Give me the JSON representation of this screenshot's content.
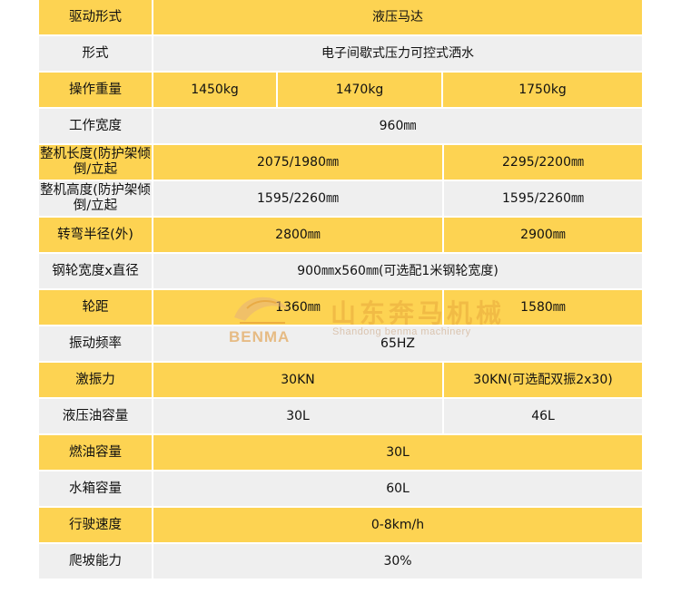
{
  "rows": [
    {
      "label": "驱动形式",
      "values": [
        "液压马达"
      ]
    },
    {
      "label": "形式",
      "values": [
        "电子间歇式压力可控式洒水"
      ]
    },
    {
      "label": "操作重量",
      "values": [
        "1450kg",
        "1470kg",
        "1750kg"
      ]
    },
    {
      "label": "工作宽度",
      "values": [
        "960㎜"
      ]
    },
    {
      "label": "整机长度(防护架倾倒/立起",
      "values": [
        "2075/1980㎜",
        "2295/2200㎜"
      ]
    },
    {
      "label": "整机高度(防护架倾倒/立起",
      "values": [
        "1595/2260㎜",
        "1595/2260㎜"
      ]
    },
    {
      "label": "转弯半径(外)",
      "values": [
        "2800㎜",
        "2900㎜"
      ]
    },
    {
      "label": "钢轮宽度x直径",
      "values": [
        "900㎜x560㎜(可选配1米钢轮宽度)"
      ]
    },
    {
      "label": "轮距",
      "values": [
        "1360㎜",
        "1580㎜"
      ]
    },
    {
      "label": "振动频率",
      "values": [
        "65HZ"
      ]
    },
    {
      "label": "激振力",
      "values": [
        "30KN",
        "30KN(可选配双振2x30)"
      ]
    },
    {
      "label": "液压油容量",
      "values": [
        "30L",
        "46L"
      ]
    },
    {
      "label": "燃油容量",
      "values": [
        "30L"
      ]
    },
    {
      "label": "水箱容量",
      "values": [
        "60L"
      ]
    },
    {
      "label": "行驶速度",
      "values": [
        "0-8km/h"
      ]
    },
    {
      "label": "爬坡能力",
      "values": [
        "30%"
      ]
    }
  ],
  "watermark": {
    "brand": "BENMA",
    "chinese": "山东奔马机械",
    "english": "Shandong benma machinery"
  },
  "colors": {
    "yellow": "#fdd352",
    "gray": "#efefef"
  }
}
